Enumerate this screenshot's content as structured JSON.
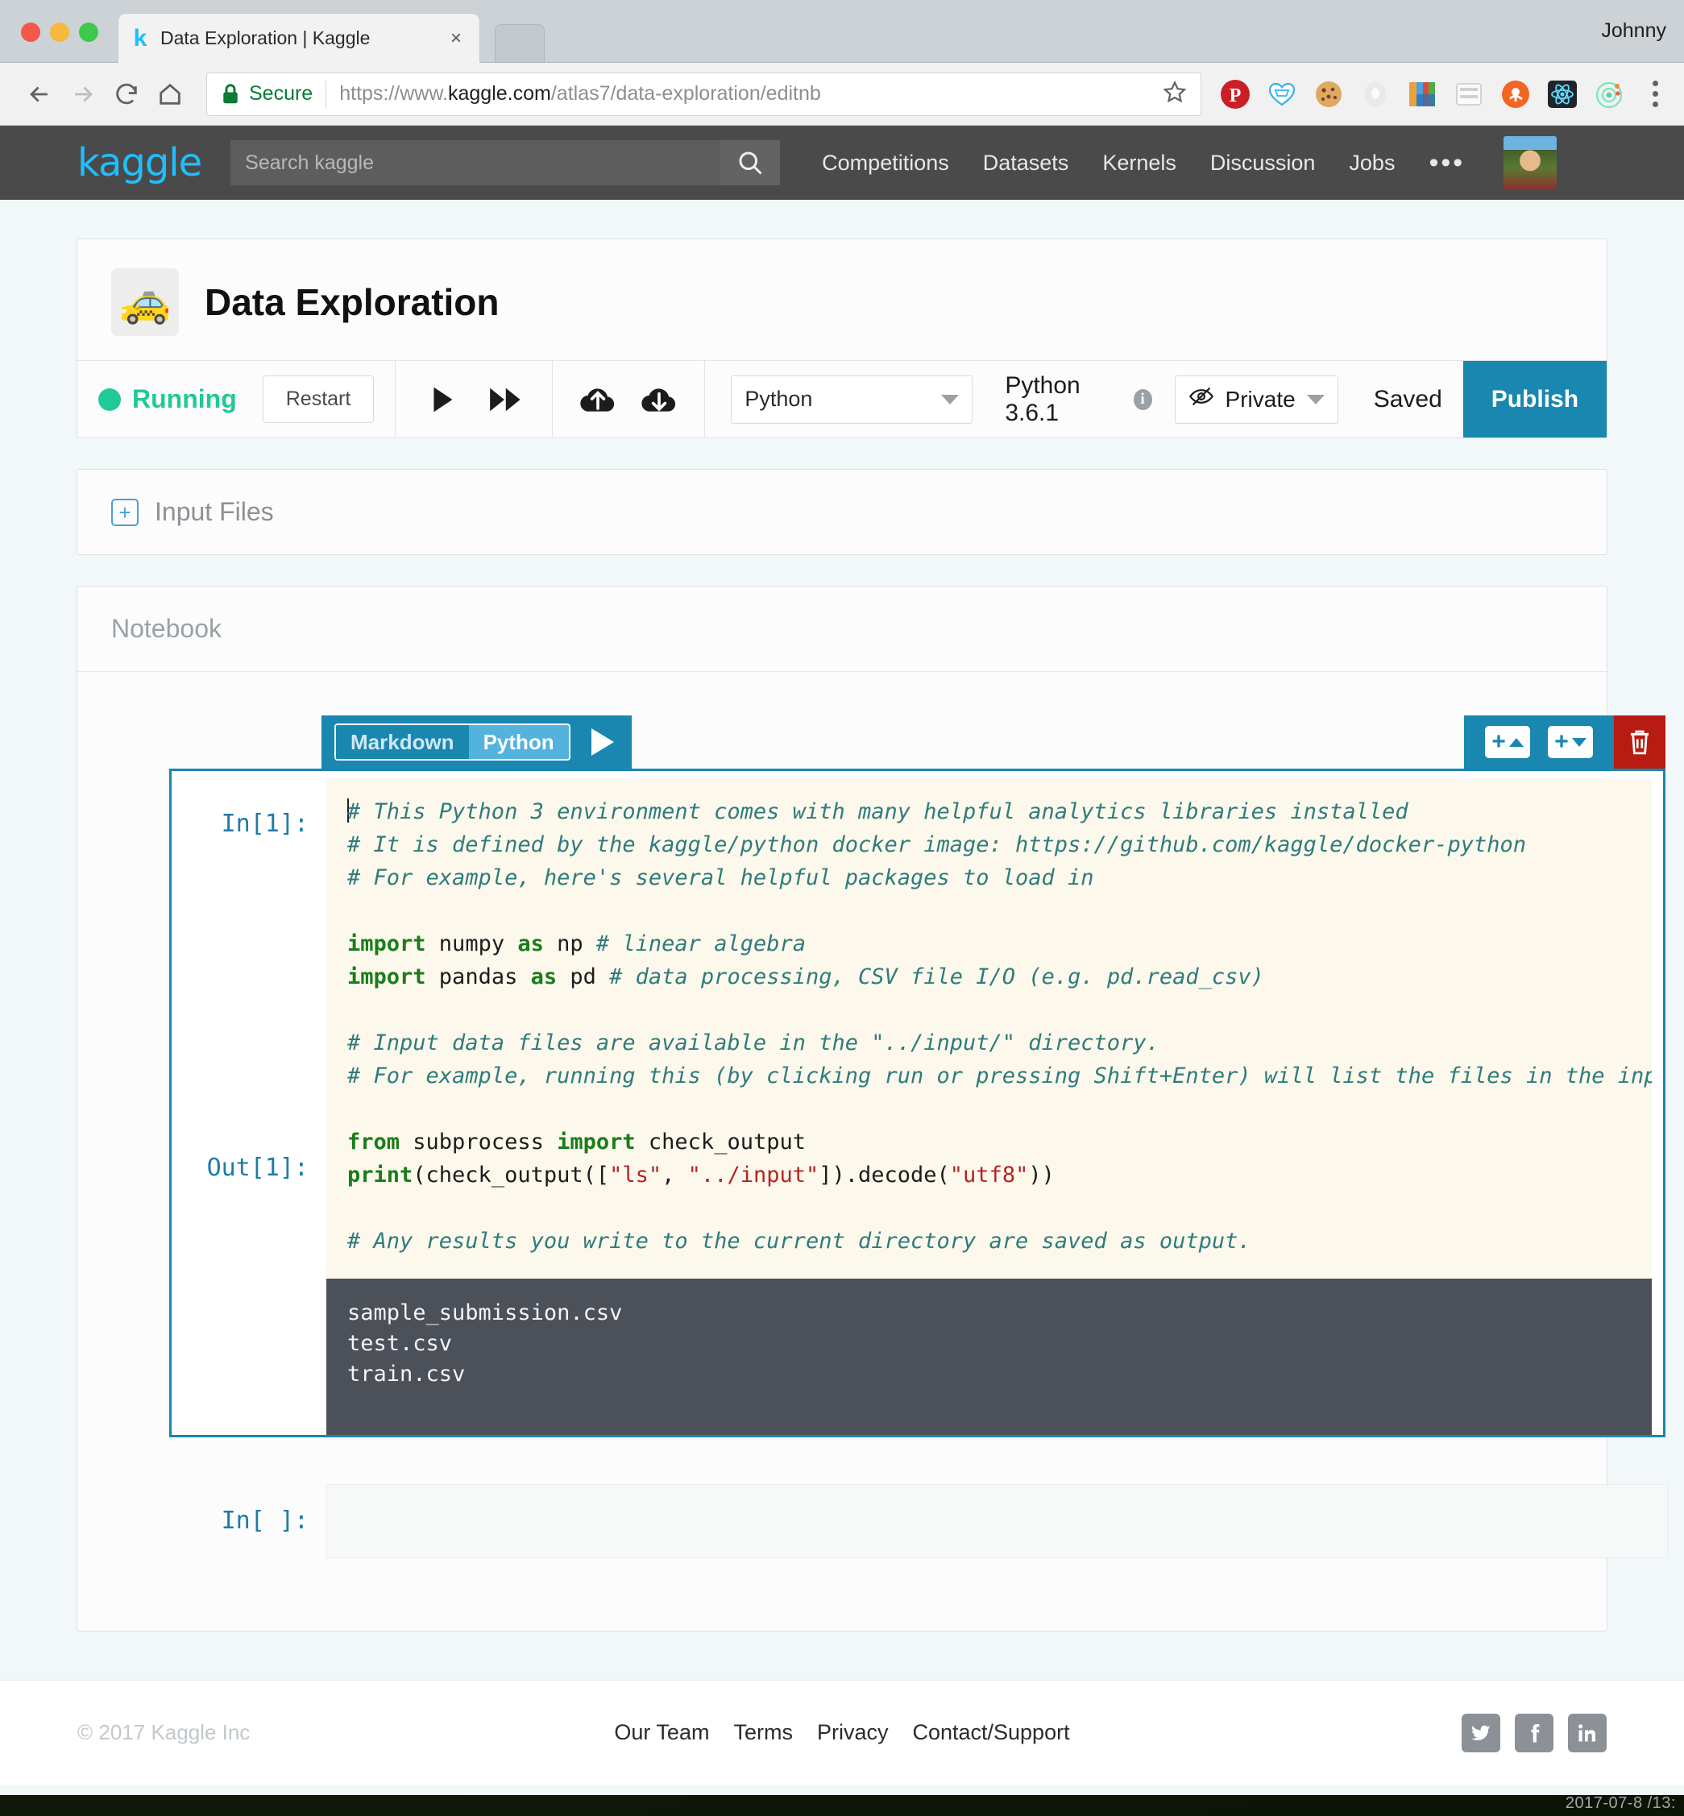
{
  "desktop": {
    "stamp": "2017-07-8 /13:"
  },
  "browser": {
    "profile_name": "Johnny",
    "tab": {
      "favicon": "k",
      "title": "Data Exploration | Kaggle",
      "close_icon": "×"
    },
    "nav": {
      "back_icon": "back-arrow-icon",
      "forward_icon": "forward-arrow-icon",
      "reload_icon": "reload-icon",
      "home_icon": "home-icon"
    },
    "omnibox": {
      "secure_label": "Secure",
      "url_scheme": "https://www.",
      "url_host": "kaggle.com",
      "url_path": "/atlas7/data-exploration/editnb",
      "star_icon": "bookmark-star-icon"
    },
    "extensions": [
      "pinterest-icon",
      "wishlist-heart-icon",
      "cookie-icon",
      "ghostery-icon",
      "colorzilla-icon",
      "discover-devtools-icon",
      "octopus-icon",
      "react-devtools-icon",
      "atom-orbit-icon"
    ],
    "menu_icon": "kebab-menu-icon"
  },
  "site_nav": {
    "logo": "kaggle",
    "search_placeholder": "Search kaggle",
    "search_value": "",
    "search_icon": "search-icon",
    "links": [
      "Competitions",
      "Datasets",
      "Kernels",
      "Discussion",
      "Jobs"
    ],
    "overflow": "•••",
    "avatar": "user-avatar"
  },
  "kernel": {
    "emoji": "🚕",
    "title": "Data Exploration",
    "status": "Running",
    "restart_label": "Restart",
    "run_icon": "run-cell-icon",
    "run_all_icon": "run-all-icon",
    "upload_icon": "cloud-upload-icon",
    "download_icon": "cloud-download-icon",
    "language": "Python",
    "language_version": "Python 3.6.1",
    "info_icon": "info-icon",
    "privacy": "Private",
    "privacy_icon": "eye-slash-icon",
    "saved_label": "Saved",
    "publish_label": "Publish"
  },
  "input_files": {
    "expand_icon": "plus-box-icon",
    "label": "Input Files"
  },
  "notebook": {
    "label": "Notebook",
    "cell_toolbar": {
      "markdown_label": "Markdown",
      "python_label": "Python",
      "active": "Python",
      "run_icon": "play-icon",
      "add_above_icon": "add-cell-above-icon",
      "add_below_icon": "add-cell-below-icon",
      "delete_icon": "trash-icon"
    },
    "cells": [
      {
        "in_label": "In[1]:",
        "out_label": "Out[1]:",
        "code_lines": [
          "# This Python 3 environment comes with many helpful analytics libraries installed",
          "# It is defined by the kaggle/python docker image: https://github.com/kaggle/docker-python",
          "# For example, here's several helpful packages to load in",
          "",
          "import numpy as np # linear algebra",
          "import pandas as pd # data processing, CSV file I/O (e.g. pd.read_csv)",
          "",
          "# Input data files are available in the \"../input/\" directory.",
          "# For example, running this (by clicking run or pressing Shift+Enter) will list the files in the input directory",
          "",
          "from subprocess import check_output",
          "print(check_output([\"ls\", \"../input\"]).decode(\"utf8\"))",
          "",
          "# Any results you write to the current directory are saved as output."
        ],
        "output_lines": [
          "sample_submission.csv",
          "test.csv",
          "train.csv"
        ]
      },
      {
        "in_label": "In[ ]:",
        "code_lines": [],
        "output_lines": []
      }
    ]
  },
  "footer": {
    "copyright": "© 2017 Kaggle Inc",
    "links": [
      "Our Team",
      "Terms",
      "Privacy",
      "Contact/Support"
    ],
    "social": [
      "twitter-icon",
      "facebook-icon",
      "linkedin-icon"
    ]
  },
  "colors": {
    "kaggle_blue": "#20beff",
    "accent_blue": "#1987b0",
    "publish_blue": "#1987b0",
    "running_green": "#20c997",
    "delete_red": "#b81b12",
    "nav_dark": "#4a4a4a",
    "output_bg": "#4c5058",
    "code_bg": "#fdf8ec"
  }
}
